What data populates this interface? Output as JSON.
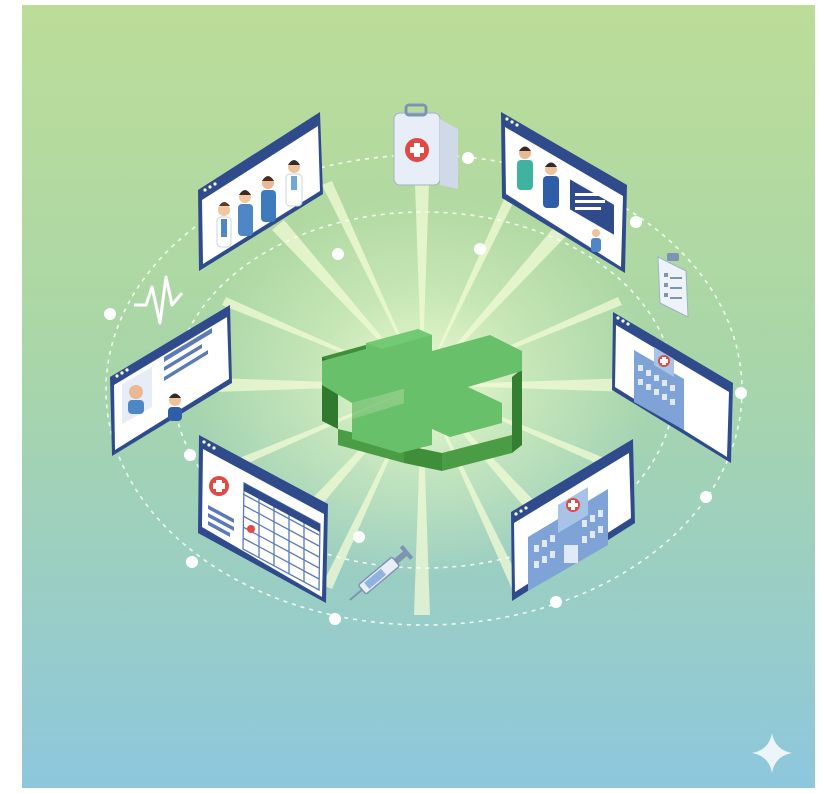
{
  "scene": {
    "background_top": "#b9dd98",
    "background_bottom": "#8fc9dc",
    "accent_green": "#5cb85c",
    "accent_red": "#e04a44",
    "window_frame": "#2f4b8c"
  },
  "icons": [
    "medical-cross-icon",
    "first-aid-kit-icon",
    "heartbeat-icon",
    "clipboard-icon",
    "syringe-icon",
    "sparkle-icon"
  ],
  "panels": [
    {
      "name": "staff-panel",
      "content": "medical-staff"
    },
    {
      "name": "consultation-panel",
      "content": "doctor-patient"
    },
    {
      "name": "patient-record-panel",
      "content": "patient-profiles"
    },
    {
      "name": "hospital-panel-right",
      "content": "hospital-building"
    },
    {
      "name": "appointment-calendar-panel",
      "content": "calendar"
    },
    {
      "name": "hospital-panel-bottom",
      "content": "hospital-building"
    }
  ]
}
